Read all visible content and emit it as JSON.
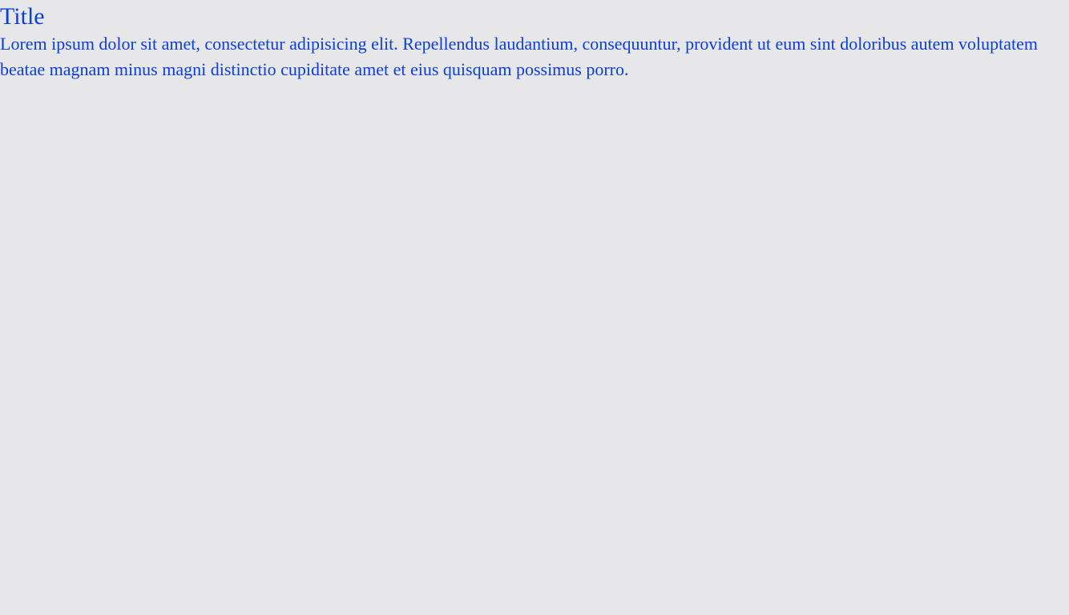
{
  "page": {
    "title": "Title",
    "body": "Lorem ipsum dolor sit amet, consectetur adipisicing elit. Repellendus laudantium, consequuntur, provident ut eum sint doloribus autem voluptatem beatae magnam minus magni distinctio cupiditate amet et eius quisquam possimus porro."
  },
  "colors": {
    "background": "#e7e7ea",
    "text": "#0b3fd6"
  }
}
